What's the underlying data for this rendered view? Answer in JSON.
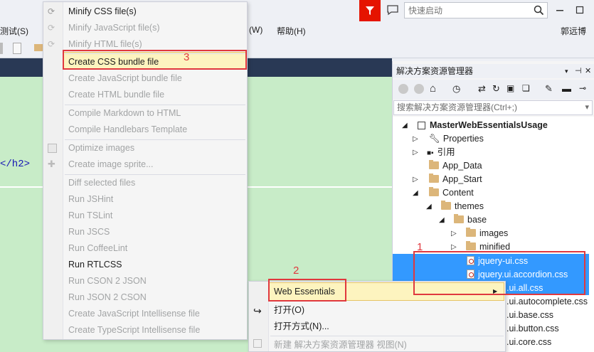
{
  "menubar": {
    "items": [
      "测试(S)",
      "(W)",
      "帮助(H)"
    ],
    "user": "郭远博"
  },
  "quick_launch": {
    "placeholder": "快速启动"
  },
  "editor": {
    "code_fragment": "</h2>"
  },
  "solution_explorer": {
    "title": "解决方案资源管理器",
    "search_placeholder": "搜索解决方案资源管理器(Ctrl+;)",
    "tree": [
      {
        "label": "MasterWebEssentialsUsage",
        "bold": true
      },
      {
        "label": "Properties"
      },
      {
        "label": "引用"
      },
      {
        "label": "App_Data"
      },
      {
        "label": "App_Start"
      },
      {
        "label": "Content"
      },
      {
        "label": "themes"
      },
      {
        "label": "base"
      },
      {
        "label": "images"
      },
      {
        "label": "minified"
      },
      {
        "label": "jquery-ui.css"
      },
      {
        "label": "jquery.ui.accordion.css"
      },
      {
        "label": ".ui.all.css"
      },
      {
        "label": ".ui.autocomplete.css"
      },
      {
        "label": ".ui.base.css"
      },
      {
        "label": ".ui.button.css"
      },
      {
        "label": ".ui.core.css"
      }
    ]
  },
  "web_essentials_menu": {
    "items": [
      {
        "label": "Minify CSS file(s)",
        "enabled": true
      },
      {
        "label": "Minify JavaScript file(s)",
        "enabled": false
      },
      {
        "label": "Minify HTML file(s)",
        "enabled": false
      },
      {
        "label": "Create CSS bundle file",
        "enabled": true
      },
      {
        "label": "Create JavaScript bundle file",
        "enabled": false
      },
      {
        "label": "Create HTML bundle file",
        "enabled": false
      },
      {
        "label": "Compile Markdown to HTML",
        "enabled": false
      },
      {
        "label": "Compile Handlebars Template",
        "enabled": false
      },
      {
        "label": "Optimize images",
        "enabled": false
      },
      {
        "label": "Create image sprite...",
        "enabled": false
      },
      {
        "label": "Diff selected files",
        "enabled": false
      },
      {
        "label": "Run JSHint",
        "enabled": false
      },
      {
        "label": "Run TSLint",
        "enabled": false
      },
      {
        "label": "Run JSCS",
        "enabled": false
      },
      {
        "label": "Run CoffeeLint",
        "enabled": false
      },
      {
        "label": "Run RTLCSS",
        "enabled": true
      },
      {
        "label": "Run CSON 2 JSON",
        "enabled": false
      },
      {
        "label": "Run JSON 2 CSON",
        "enabled": false
      },
      {
        "label": "Create JavaScript Intellisense file",
        "enabled": false
      },
      {
        "label": "Create TypeScript Intellisense file",
        "enabled": false
      }
    ]
  },
  "context_menu": {
    "items": [
      {
        "label": "Web Essentials",
        "enabled": true
      },
      {
        "label": "打开(O)",
        "enabled": true
      },
      {
        "label": "打开方式(N)...",
        "enabled": true
      },
      {
        "label": "新建 解决方案资源管理器 视图(N)",
        "enabled": false
      }
    ]
  },
  "annotations": {
    "step1": "1",
    "step2": "2",
    "step3": "3"
  },
  "colors": {
    "accent_blue": "#3399ff",
    "editor_bg": "#c8ecc8",
    "annotation_red": "#e0383e",
    "flag_red": "#e51400"
  }
}
